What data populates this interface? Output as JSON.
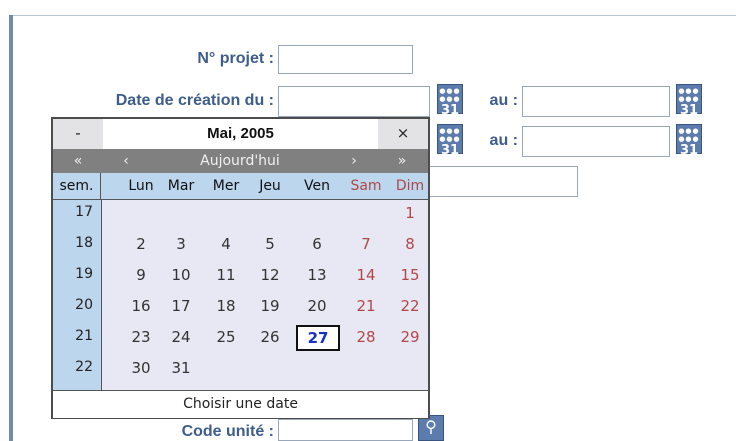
{
  "form": {
    "projet_label": "N° projet :",
    "creation_label": "Date de création du :",
    "au_label_1": "au :",
    "au_label_2": "au :",
    "unite_label": "Code unité :",
    "calendar_icon_num": "31"
  },
  "calendar": {
    "prev_button": "-",
    "title": "Mai, 2005",
    "close_button": "×",
    "nav": {
      "prev_year": "«",
      "prev_month": "‹",
      "today": "Aujourd'hui",
      "next_month": "›",
      "next_year": "»"
    },
    "weekday_headers": [
      "sem.",
      "Lun",
      "Mar",
      "Mer",
      "Jeu",
      "Ven",
      "Sam",
      "Dim"
    ],
    "weeks": [
      {
        "num": "17",
        "days": [
          "",
          "",
          "",
          "",
          "",
          "",
          "1"
        ]
      },
      {
        "num": "18",
        "days": [
          "2",
          "3",
          "4",
          "5",
          "6",
          "7",
          "8"
        ]
      },
      {
        "num": "19",
        "days": [
          "9",
          "10",
          "11",
          "12",
          "13",
          "14",
          "15"
        ]
      },
      {
        "num": "20",
        "days": [
          "16",
          "17",
          "18",
          "19",
          "20",
          "21",
          "22"
        ]
      },
      {
        "num": "21",
        "days": [
          "23",
          "24",
          "25",
          "26",
          "27",
          "28",
          "29"
        ]
      },
      {
        "num": "22",
        "days": [
          "30",
          "31",
          "",
          "",
          "",
          "",
          ""
        ]
      }
    ],
    "selected_day": "27",
    "footer": "Choisir une date"
  },
  "colors": {
    "label": "#3f5d8c",
    "weekend": "#b04848",
    "today": "#1a2fc8",
    "week_column": "#bcd6ee",
    "nav_bar": "#808080"
  }
}
